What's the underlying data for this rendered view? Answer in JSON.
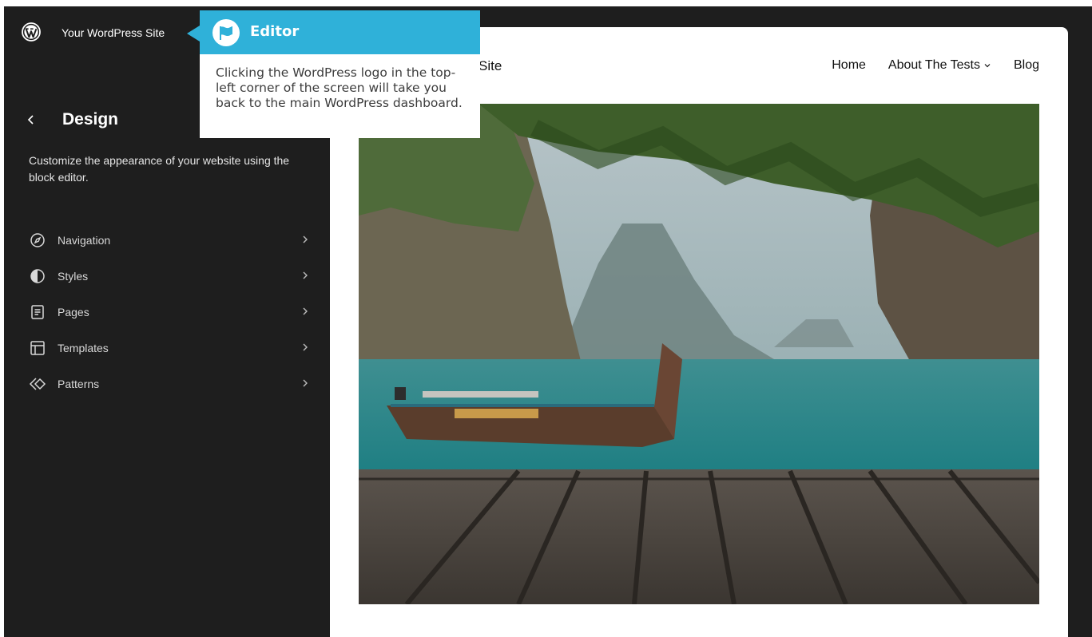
{
  "header": {
    "site_name": "Your WordPress Site"
  },
  "sidebar": {
    "title": "Design",
    "description": "Customize the appearance of your website using the block editor.",
    "items": [
      {
        "label": "Navigation",
        "icon": "navigation-icon"
      },
      {
        "label": "Styles",
        "icon": "styles-icon"
      },
      {
        "label": "Pages",
        "icon": "pages-icon"
      },
      {
        "label": "Templates",
        "icon": "templates-icon"
      },
      {
        "label": "Patterns",
        "icon": "patterns-icon"
      }
    ]
  },
  "preview": {
    "site_title_partial": "Site",
    "nav": [
      {
        "label": "Home"
      },
      {
        "label": "About The Tests"
      },
      {
        "label": "Blog"
      }
    ]
  },
  "tour": {
    "title": "Editor",
    "body": "Clicking the WordPress logo in the top-left corner of the screen will take you back to the main WordPress dashboard.",
    "accent": "#2fb1d9"
  },
  "colors": {
    "sidebar_bg": "#1e1e1e",
    "text": "#ffffff"
  }
}
